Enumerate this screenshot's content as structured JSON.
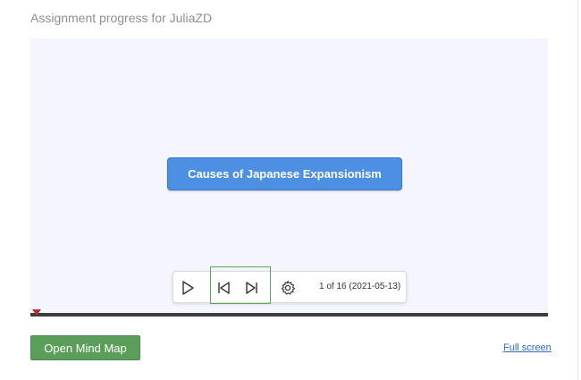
{
  "page": {
    "title": "Assignment progress for JuliaZD"
  },
  "mindmap": {
    "root_node_label": "Causes of Japanese Expansionism",
    "background_color": "#f4f5fe",
    "node_color": "#4d8fe3"
  },
  "player": {
    "play_icon": "play-icon",
    "step_back_icon": "step-back-icon",
    "step_forward_icon": "step-forward-icon",
    "settings_icon": "gear-icon",
    "progress_text": "1 of 16 (2021-05-13)",
    "timeline_position_fraction": 0
  },
  "actions": {
    "open_button_label": "Open Mind Map",
    "fullscreen_link_label": "Full screen",
    "open_button_color": "#5a9e5a"
  }
}
